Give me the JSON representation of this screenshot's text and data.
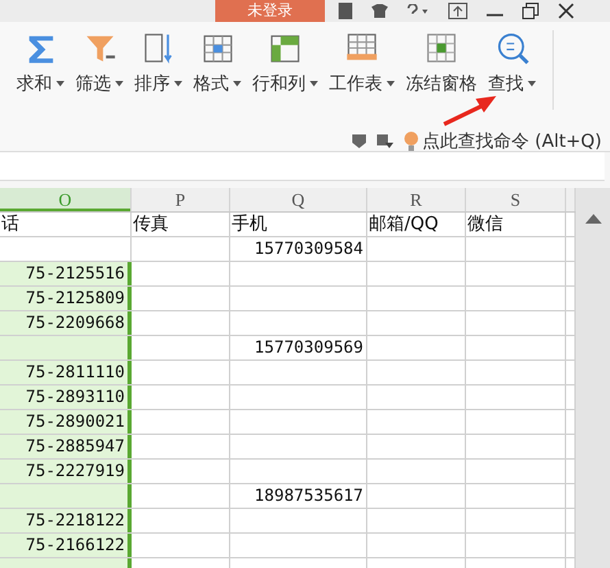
{
  "title_bar": {
    "account_tab": "未登录"
  },
  "ribbon": {
    "tools": [
      {
        "label": "求和",
        "kind": "sum",
        "dropdown": true
      },
      {
        "label": "筛选",
        "kind": "filter",
        "dropdown": true
      },
      {
        "label": "排序",
        "kind": "sort",
        "dropdown": true
      },
      {
        "label": "格式",
        "kind": "format",
        "dropdown": true
      },
      {
        "label": "行和列",
        "kind": "rows",
        "dropdown": true
      },
      {
        "label": "工作表",
        "kind": "sheet",
        "dropdown": true
      },
      {
        "label": "冻结窗格",
        "kind": "freeze",
        "dropdown": false
      },
      {
        "label": "查找",
        "kind": "find",
        "dropdown": true
      }
    ],
    "command_search": "点此查找命令 (Alt+Q)"
  },
  "sheet": {
    "columns": [
      {
        "label": "O",
        "selected": true
      },
      {
        "label": "P",
        "selected": false
      },
      {
        "label": "Q",
        "selected": false
      },
      {
        "label": "R",
        "selected": false
      },
      {
        "label": "S",
        "selected": false
      }
    ],
    "header_row": [
      "话",
      "传真",
      "手机",
      "邮箱/QQ",
      "微信"
    ],
    "rows": [
      {
        "column_o": "",
        "column_q": "15770309584",
        "selected": false
      },
      {
        "column_o": "75-2125516",
        "column_q": "",
        "selected": true
      },
      {
        "column_o": "75-2125809",
        "column_q": "",
        "selected": true
      },
      {
        "column_o": "75-2209668",
        "column_q": "",
        "selected": true
      },
      {
        "column_o": "",
        "column_q": "15770309569",
        "selected": true
      },
      {
        "column_o": "75-2811110",
        "column_q": "",
        "selected": true
      },
      {
        "column_o": "75-2893110",
        "column_q": "",
        "selected": true
      },
      {
        "column_o": "75-2890021",
        "column_q": "",
        "selected": true
      },
      {
        "column_o": "75-2885947",
        "column_q": "",
        "selected": true
      },
      {
        "column_o": "75-2227919",
        "column_q": "",
        "selected": true
      },
      {
        "column_o": "",
        "column_q": "18987535617",
        "selected": true
      },
      {
        "column_o": "75-2218122",
        "column_q": "",
        "selected": true
      },
      {
        "column_o": "75-2166122",
        "column_q": "",
        "selected": true
      },
      {
        "column_o": "",
        "column_q": "",
        "selected": true
      }
    ]
  }
}
